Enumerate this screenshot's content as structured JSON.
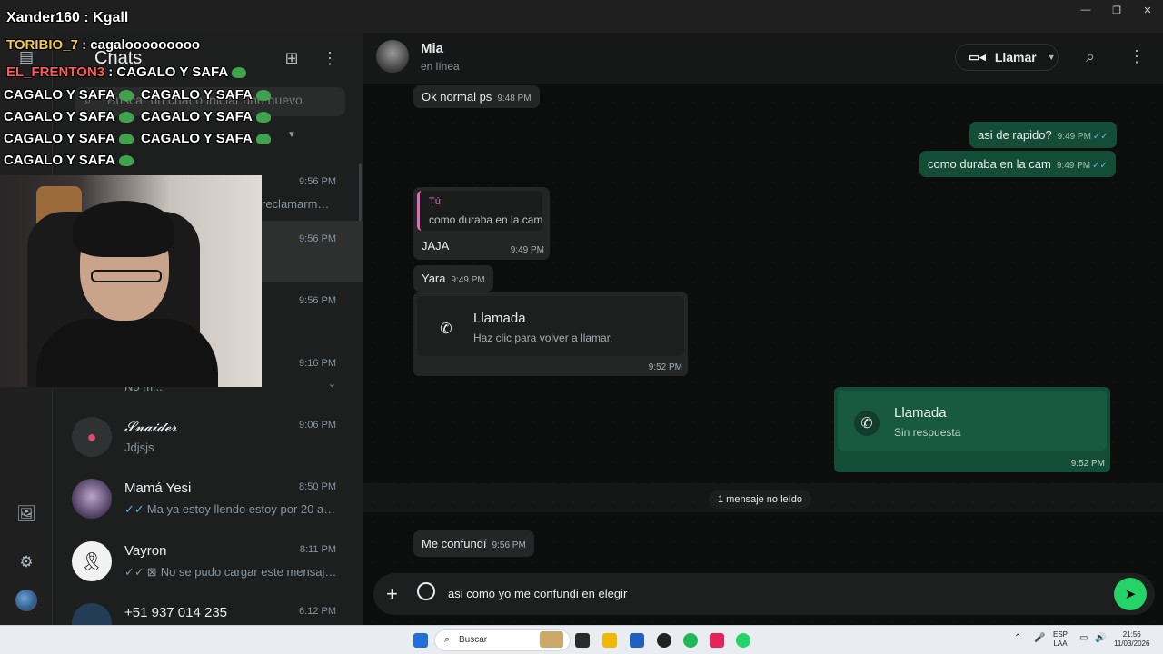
{
  "window": {
    "min": "—",
    "max": "❐",
    "close": "✕"
  },
  "chatlist": {
    "title": "Chats",
    "search_placeholder": "Buscar un chat o iniciar uno nuevo",
    "items": [
      {
        "time": "9:56 PM",
        "preview": "reclamarme…"
      },
      {
        "time": "9:56 PM",
        "preview": ""
      },
      {
        "time": "9:56 PM",
        "preview": ""
      },
      {
        "time": "9:16 PM",
        "preview": "No m..."
      },
      {
        "name": "𝓢𝓷𝓪𝓲𝓭𝓮𝓻",
        "time": "9:06 PM",
        "preview": "Jdjsjs"
      },
      {
        "name": "Mamá Yesi",
        "time": "8:50 PM",
        "preview": "Ma ya estoy llendo estoy por 20 aho…"
      },
      {
        "name": "Vayron",
        "time": "8:11 PM",
        "preview": "No se pudo cargar este mensaje…"
      },
      {
        "name": "+51 937 014 235",
        "time": "6:12 PM",
        "preview": ""
      }
    ]
  },
  "conversation": {
    "contact_name": "Mia",
    "contact_status": "en línea",
    "call_label": "Llamar",
    "messages": [
      {
        "text": "Ok normal ps",
        "time": "9:48 PM"
      },
      {
        "text": "asi de rapido?",
        "time": "9:49 PM"
      },
      {
        "text": "como duraba en la cam",
        "time": "9:49 PM"
      },
      {
        "quote_author": "Tú",
        "quote_text": "como duraba en la cam",
        "text": "JAJA",
        "time": "9:49 PM"
      },
      {
        "text": "Yara",
        "time": "9:49 PM"
      },
      {
        "title": "Llamada",
        "subtitle": "Haz clic para volver a llamar.",
        "time": "9:52 PM"
      },
      {
        "title": "Llamada",
        "subtitle": "Sin respuesta",
        "time": "9:52 PM"
      },
      {
        "text": "Me confundí",
        "time": "9:56 PM"
      }
    ],
    "unread_label": "1 mensaje no leído",
    "composer_text": "asi como yo me confundi en elegir"
  },
  "overlay": {
    "lines": [
      {
        "user": "Xander160",
        "sep": " : ",
        "text": "Kgall"
      },
      {
        "user": "TORIBIO_7",
        "sep": " : ",
        "text": "cagalooooooooo"
      },
      {
        "user": "EL_FRENTON3",
        "sep": " : ",
        "text": "CAGALO Y SAFA"
      },
      {
        "text": "CAGALO Y SAFA"
      },
      {
        "text": "CAGALO Y SAFA"
      },
      {
        "text": "CAGALO Y SAFA"
      },
      {
        "text": "CAGALO Y SAFA"
      },
      {
        "text": "CAGALO Y SAFA"
      },
      {
        "text": "CAGALO Y SAFA"
      },
      {
        "text": "CAGALO Y SAFA"
      }
    ]
  },
  "taskbar": {
    "search_label": "Buscar",
    "lang_1": "ESP",
    "lang_2": "LAA",
    "time": "21:56",
    "date": "11/03/2026"
  },
  "colors": {
    "accent_green": "#25d366",
    "outgoing_bubble": "#144d37",
    "read_ticks": "#53bdeb"
  }
}
